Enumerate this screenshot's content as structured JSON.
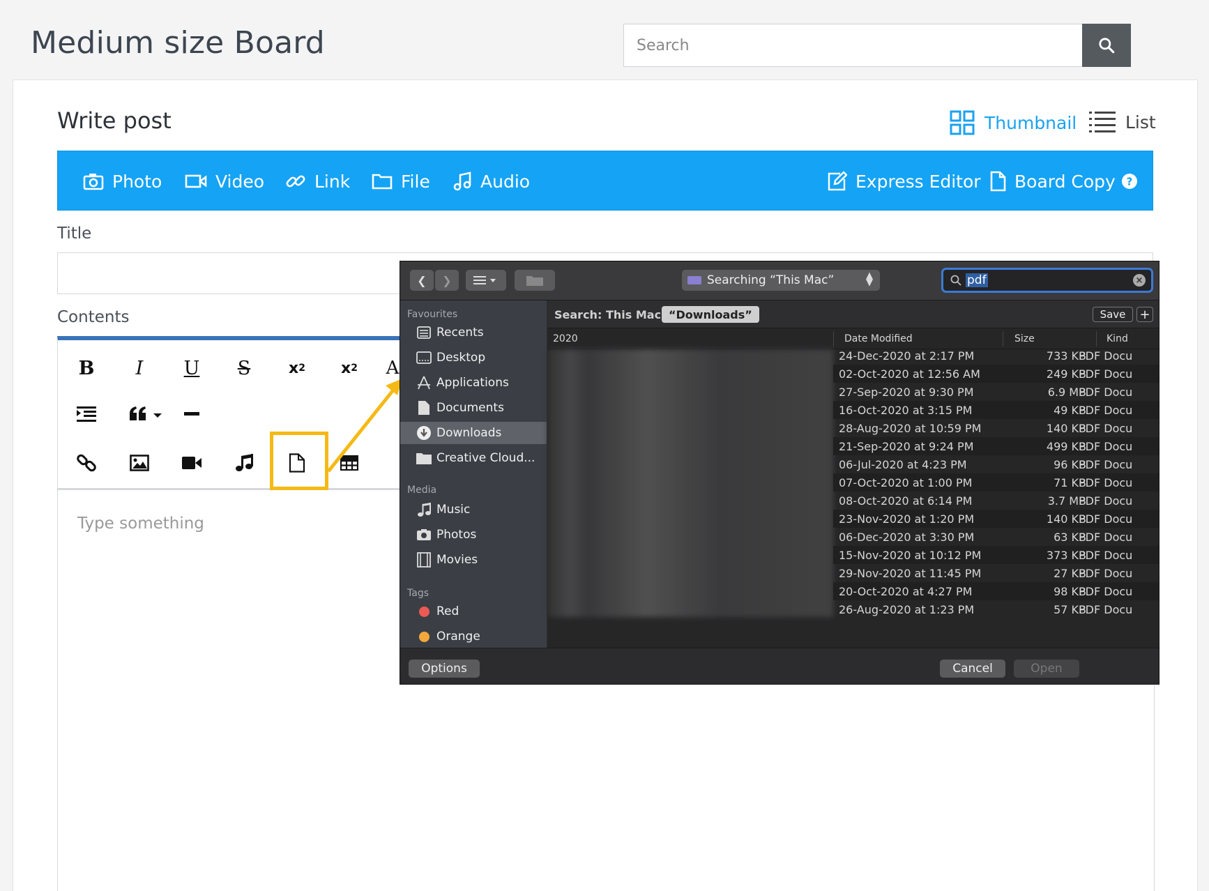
{
  "header": {
    "title": "Medium size Board",
    "search_placeholder": "Search"
  },
  "post": {
    "heading": "Write post",
    "view": {
      "thumbnail": "Thumbnail",
      "list": "List"
    },
    "toolbar": {
      "photo": "Photo",
      "video": "Video",
      "link": "Link",
      "file": "File",
      "audio": "Audio",
      "express_editor": "Express Editor",
      "board_copy": "Board Copy"
    },
    "title_label": "Title",
    "contents_label": "Contents",
    "editor_placeholder": "Type something",
    "colors": {
      "accent": "#14a3f5",
      "editor_top": "#3a73b8",
      "highlight": "#f5b915"
    }
  },
  "dialog": {
    "location": "Searching “This Mac”",
    "search_query": "pdf",
    "scope": {
      "label": "Search:",
      "this_mac": "This Mac",
      "downloads": "“Downloads”"
    },
    "save": "Save",
    "plus": "+",
    "columns": {
      "name": "2020",
      "date": "Date Modified",
      "size": "Size",
      "kind": "Kind"
    },
    "sidebar": {
      "favourites_head": "Favourites",
      "favourites": [
        {
          "label": "Recents",
          "icon": "recents-icon"
        },
        {
          "label": "Desktop",
          "icon": "desktop-icon"
        },
        {
          "label": "Applications",
          "icon": "applications-icon"
        },
        {
          "label": "Documents",
          "icon": "documents-icon"
        },
        {
          "label": "Downloads",
          "icon": "downloads-icon",
          "selected": true
        },
        {
          "label": "Creative Cloud...",
          "icon": "folder-icon"
        }
      ],
      "media_head": "Media",
      "media": [
        {
          "label": "Music",
          "icon": "music-icon"
        },
        {
          "label": "Photos",
          "icon": "photos-icon"
        },
        {
          "label": "Movies",
          "icon": "movies-icon"
        }
      ],
      "tags_head": "Tags",
      "tags": [
        {
          "label": "Red",
          "color": "#ec5a55"
        },
        {
          "label": "Orange",
          "color": "#f2a93b"
        }
      ]
    },
    "rows": [
      {
        "date": "24-Dec-2020 at 2:17 PM",
        "size": "733 KB",
        "kind": "PDF Docu"
      },
      {
        "date": "02-Oct-2020 at 12:56 AM",
        "size": "249 KB",
        "kind": "PDF Docu"
      },
      {
        "date": "27-Sep-2020 at 9:30 PM",
        "size": "6.9 MB",
        "kind": "PDF Docu"
      },
      {
        "date": "16-Oct-2020 at 3:15 PM",
        "size": "49 KB",
        "kind": "PDF Docu"
      },
      {
        "date": "28-Aug-2020 at 10:59 PM",
        "size": "140 KB",
        "kind": "PDF Docu"
      },
      {
        "date": "21-Sep-2020 at 9:24 PM",
        "size": "499 KB",
        "kind": "PDF Docu"
      },
      {
        "date": "06-Jul-2020 at 4:23 PM",
        "size": "96 KB",
        "kind": "PDF Docu"
      },
      {
        "date": "07-Oct-2020 at 1:00 PM",
        "size": "71 KB",
        "kind": "PDF Docu"
      },
      {
        "date": "08-Oct-2020 at 6:14 PM",
        "size": "3.7 MB",
        "kind": "PDF Docu"
      },
      {
        "date": "23-Nov-2020 at 1:20 PM",
        "size": "140 KB",
        "kind": "PDF Docu"
      },
      {
        "date": "06-Dec-2020 at 3:30 PM",
        "size": "63 KB",
        "kind": "PDF Docu"
      },
      {
        "date": "15-Nov-2020 at 10:12 PM",
        "size": "373 KB",
        "kind": "PDF Docu"
      },
      {
        "date": "29-Nov-2020 at 11:45 PM",
        "size": "27 KB",
        "kind": "PDF Docu"
      },
      {
        "date": "20-Oct-2020 at 4:27 PM",
        "size": "98 KB",
        "kind": "PDF Docu"
      },
      {
        "date": "26-Aug-2020 at 1:23 PM",
        "size": "57 KB",
        "kind": "PDF Docu"
      }
    ],
    "buttons": {
      "options": "Options",
      "cancel": "Cancel",
      "open": "Open"
    }
  }
}
